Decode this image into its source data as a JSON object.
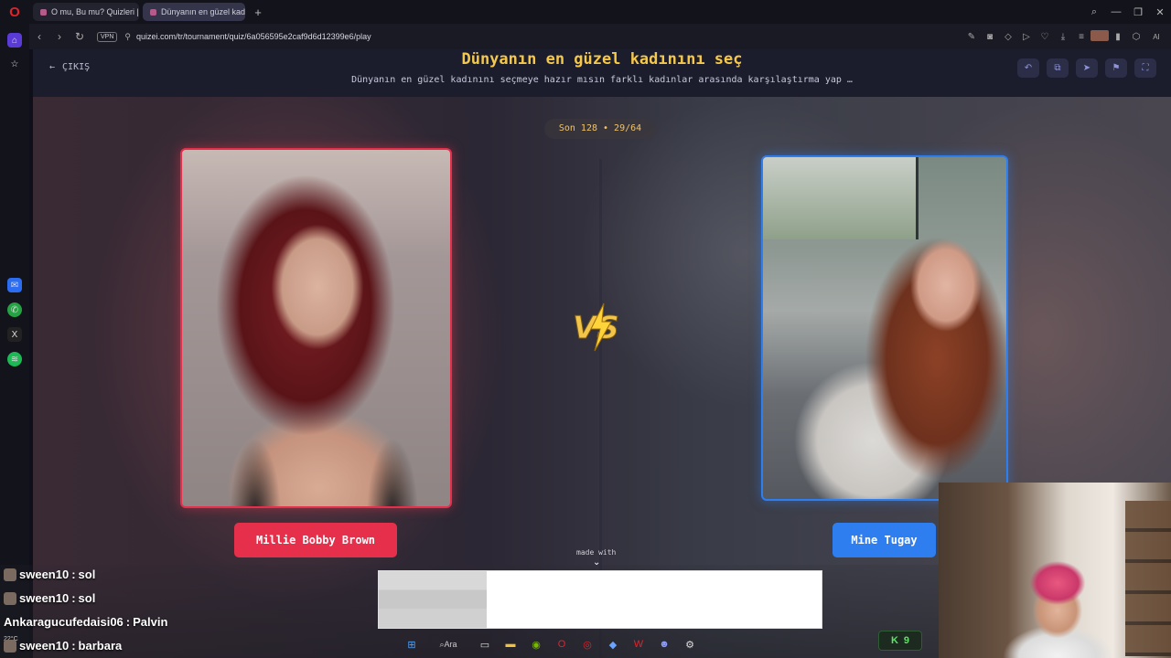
{
  "browser": {
    "tabs": [
      {
        "label": "O mu, Bu mu? Quizleri | T"
      },
      {
        "label": "Dünyanın en güzel kadını"
      }
    ],
    "url": "quizei.com/tr/tournament/quiz/6a056595e2caf9d6d12399e6/play",
    "vpn_label": "VPN"
  },
  "page": {
    "exit_label": "ÇIKIŞ",
    "title": "Dünyanın en güzel kadınını seç",
    "subtitle": "Dünyanın en güzel kadınını seçmeye hazır mısın farklı kadınlar arasında karşılaştırma yap …",
    "round_status": "Son 128 • 29/64",
    "vs_label": "VS",
    "left_choice": {
      "name": "Millie Bobby Brown",
      "accent": "#e62f4a"
    },
    "right_choice": {
      "name": "Mine Tugay",
      "accent": "#2f7ef0"
    },
    "made_with": "made with"
  },
  "chat": [
    {
      "user": "sween10",
      "message": "sol"
    },
    {
      "user": "sween10",
      "message": "sol"
    },
    {
      "user": "Ankaragucufedaisi06",
      "message": "Palvin"
    },
    {
      "user": "sween10",
      "message": "barbara"
    }
  ],
  "taskbar": {
    "search_label": "Ara",
    "counter": "9",
    "weather": "22°C"
  }
}
